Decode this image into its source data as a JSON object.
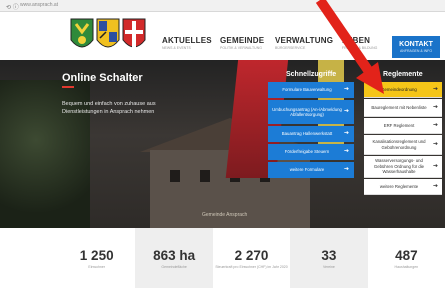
{
  "browser": {
    "nav": "⟲ ⓘ",
    "url": "www.ansprach.at"
  },
  "menu": [
    {
      "label": "AKTUELLES",
      "sub": "NEWS & EVENTS"
    },
    {
      "label": "GEMEINDE",
      "sub": "POLITIK & VERWALTUNG"
    },
    {
      "label": "VERWALTUNG",
      "sub": "BÜRGERSERVICE"
    },
    {
      "label": "LEBEN",
      "sub": "FREIZEIT & BILDUNG"
    }
  ],
  "kontakt": {
    "label": "KONTAKT",
    "sub": "ANFRAGEN & INFO"
  },
  "hero": {
    "title": "Online Schalter",
    "text": "Bequem und einfach von zuhause aus Dienstleistungen in Ansprach nehmen",
    "sign": "Gemeinde Ansprach"
  },
  "quick": {
    "title": "Schnellzugriffe",
    "items": [
      "Formulare Bauverwaltung",
      "Umbuchungsantrag (An-/Abmeldung Abfallentsorgung)",
      "Bauantrag Hallenwerkstatt",
      "Förderfreigabe Steuern",
      "weitere Formulare"
    ]
  },
  "regulations": {
    "title": "Reglemente",
    "items": [
      "Gemeindeordnung",
      "Baureglement mit Nebenliste",
      "ERF Reglement",
      "Kanalisationsreglement und Gebührenordnung",
      "Wasserversorgungs- und Gebühren Ordnung für die Wasserhaushalte",
      "weitere Reglemente"
    ]
  },
  "stats": [
    {
      "value": "1 250",
      "label": "Einwohner"
    },
    {
      "value": "863 ha",
      "label": "Gemeindefläche"
    },
    {
      "value": "2 270",
      "label": "Steuerkraft pro Einwohner (CHF) im Jahr 2020"
    },
    {
      "value": "33",
      "label": "Vereine"
    },
    {
      "value": "487",
      "label": "Haushaltungen"
    }
  ],
  "colors": {
    "accent_blue": "#1c7cd6",
    "highlight_yellow": "#f5c518",
    "arrow_red": "#e2231a"
  }
}
